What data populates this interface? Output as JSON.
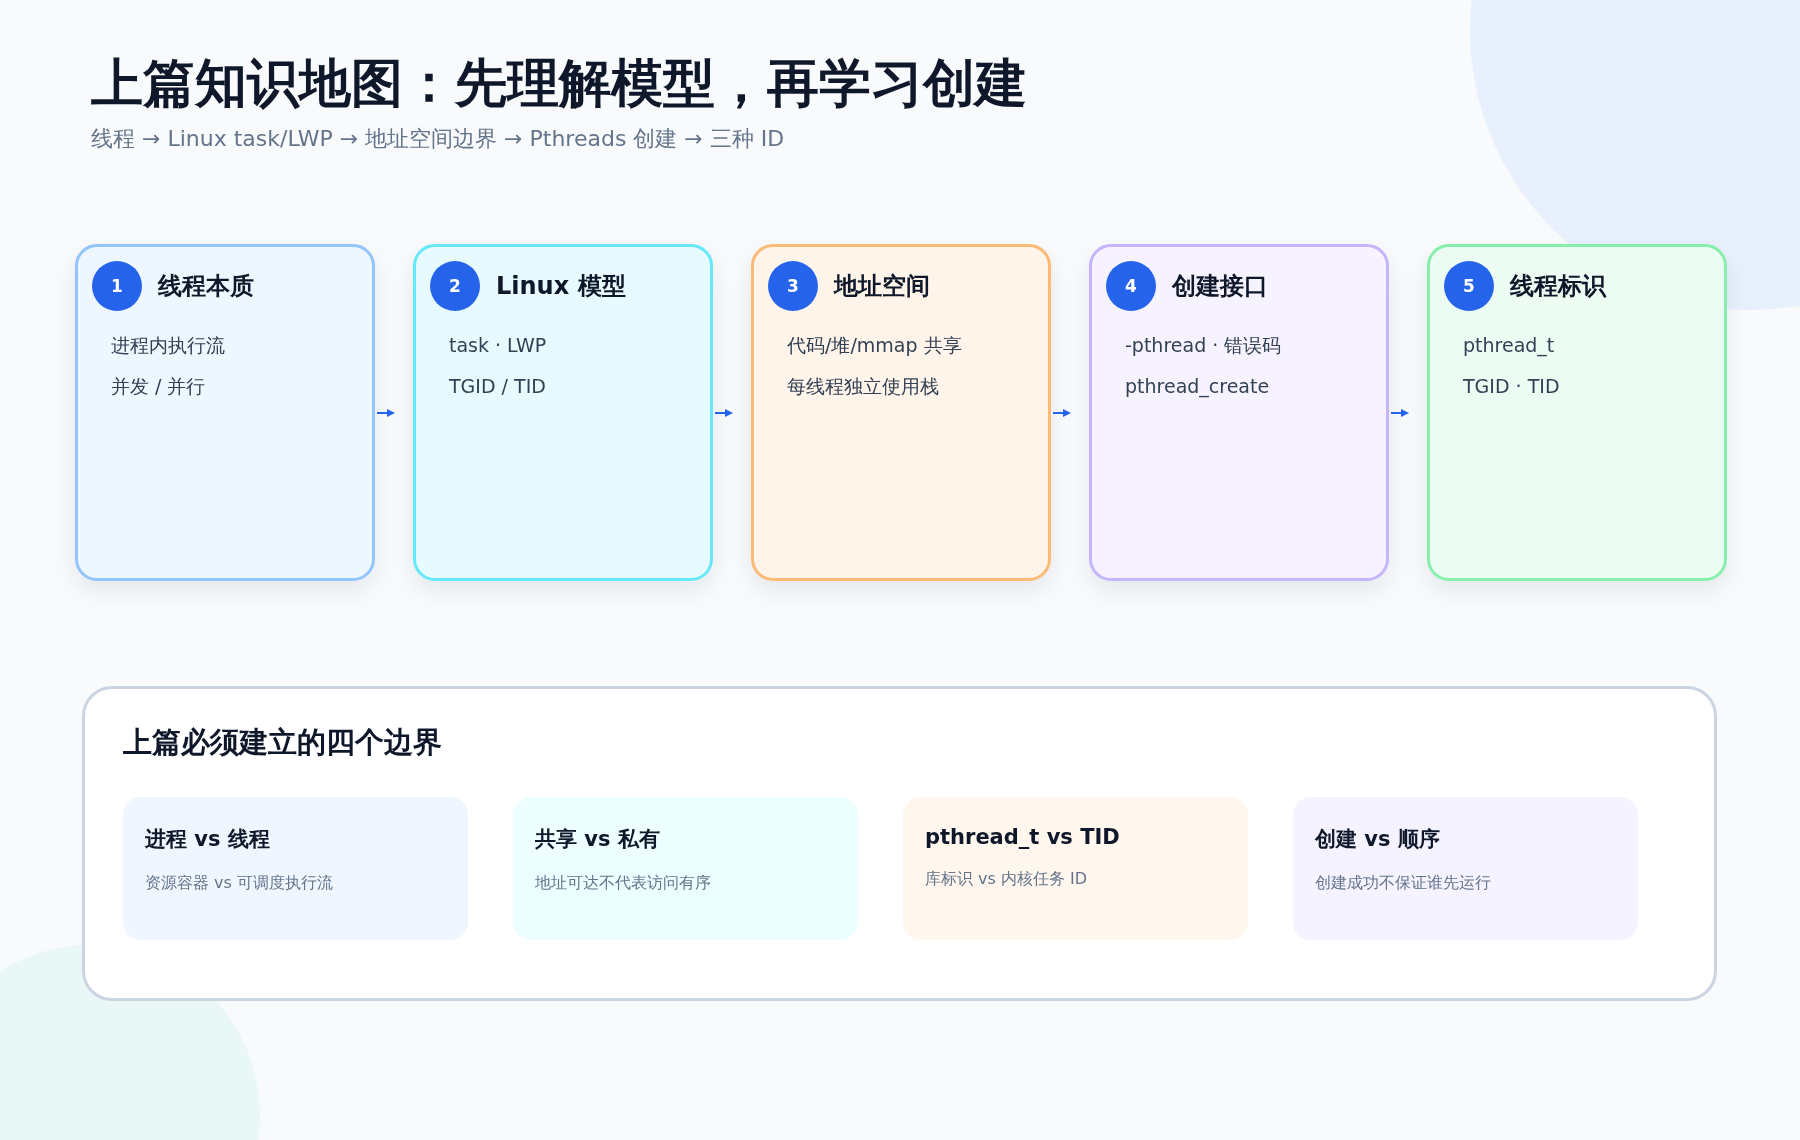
{
  "title": "上篇知识地图：先理解模型，再学习创建",
  "subtitle": "线程 → Linux task/LWP → 地址空间边界 → Pthreads 创建 → 三种 ID",
  "steps": [
    {
      "number": "1",
      "title": "线程本质",
      "color": "#93c5fd",
      "lines": [
        "进程内执行流",
        "并发 / 并行"
      ]
    },
    {
      "number": "2",
      "title": "Linux 模型",
      "color": "#67e8f9",
      "lines": [
        "task · LWP",
        "TGID / TID"
      ]
    },
    {
      "number": "3",
      "title": "地址空间",
      "color": "#fdba74",
      "lines": [
        "代码/堆/mmap 共享",
        "每线程独立使用栈"
      ]
    },
    {
      "number": "4",
      "title": "创建接口",
      "color": "#c4b5fd",
      "lines": [
        "-pthread · 错误码",
        "pthread_create"
      ]
    },
    {
      "number": "5",
      "title": "线程标识",
      "color": "#86efac",
      "lines": [
        "pthread_t",
        "TGID · TID"
      ]
    }
  ],
  "boundaries": {
    "title": "上篇必须建立的四个边界",
    "items": [
      {
        "title": "进程 vs 线程",
        "text": "资源容器 vs 可调度执行流",
        "color": "#eff6ff"
      },
      {
        "title": "共享 vs 私有",
        "text": "地址可达不代表访问有序",
        "color": "#ecfeff"
      },
      {
        "title": "pthread_t vs TID",
        "text": "库标识 vs 内核任务 ID",
        "color": "#fff7ed"
      },
      {
        "title": "创建 vs 顺序",
        "text": "创建成功不保证谁先运行",
        "color": "#f5f3ff"
      }
    ]
  }
}
